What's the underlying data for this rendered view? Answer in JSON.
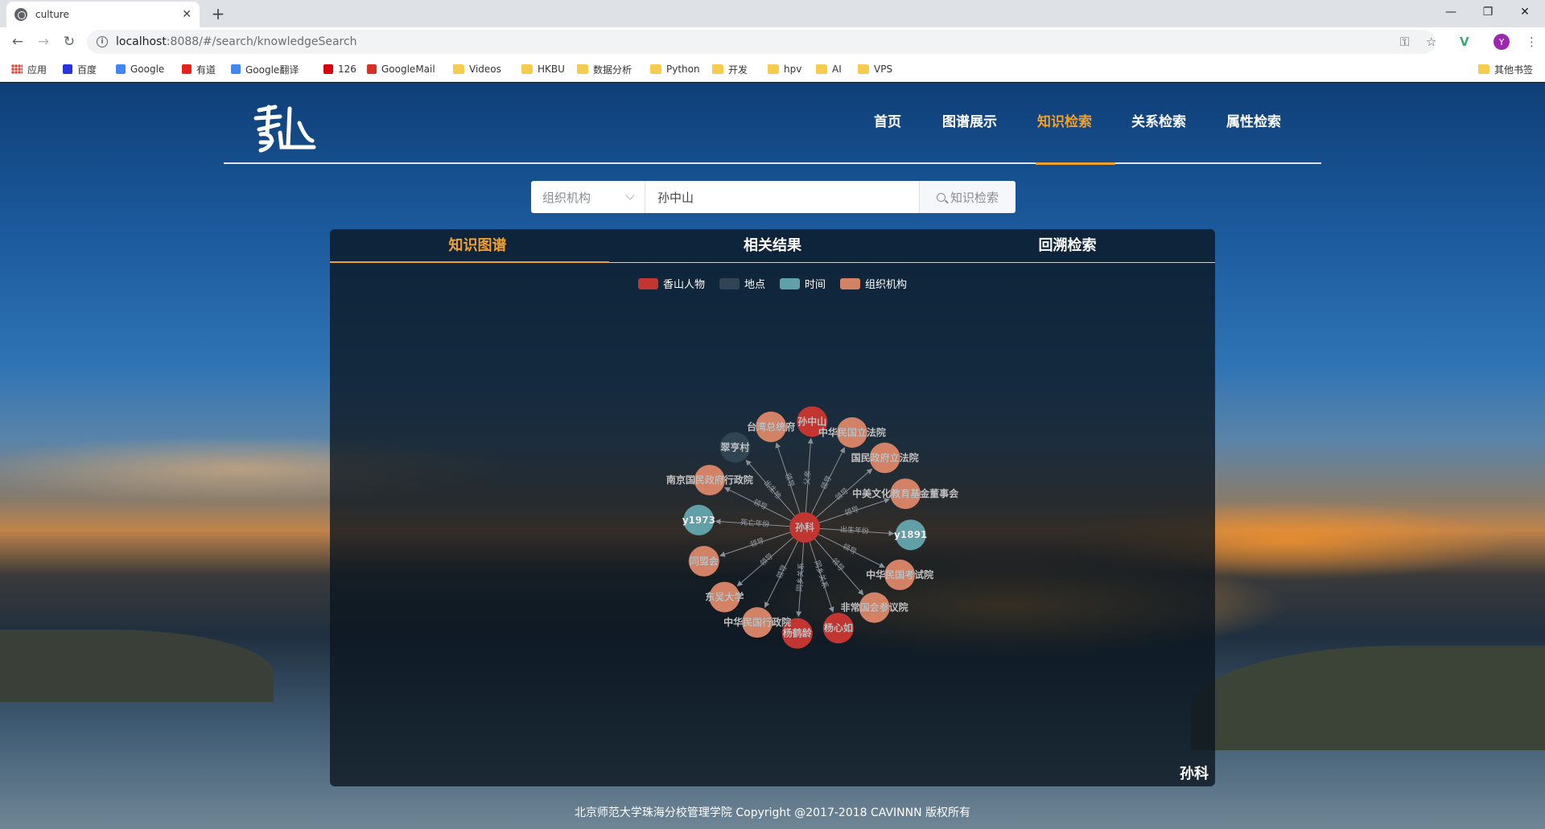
{
  "browser": {
    "tab_title": "culture",
    "url_host": "localhost",
    "url_path": ":8088/#/search/knowledgeSearch",
    "avatar_letter": "Y",
    "bookmarks": [
      {
        "label": "应用",
        "icon": "apps-icon"
      },
      {
        "label": "百度",
        "icon": "baidu-icon"
      },
      {
        "label": "Google",
        "icon": "google-icon"
      },
      {
        "label": "有道",
        "icon": "youdao-icon"
      },
      {
        "label": "Google翻译",
        "icon": "translate-icon"
      },
      {
        "label": "126",
        "icon": "netease-icon"
      },
      {
        "label": "GoogleMail",
        "icon": "gmail-icon"
      },
      {
        "label": "Videos",
        "icon": "folder-icon"
      },
      {
        "label": "HKBU",
        "icon": "folder-icon"
      },
      {
        "label": "数据分析",
        "icon": "folder-icon"
      },
      {
        "label": "Python",
        "icon": "folder-icon"
      },
      {
        "label": "开发",
        "icon": "folder-icon"
      },
      {
        "label": "hpv",
        "icon": "folder-icon"
      },
      {
        "label": "AI",
        "icon": "folder-icon"
      },
      {
        "label": "VPS",
        "icon": "folder-icon"
      }
    ],
    "other_bookmarks": "其他书签"
  },
  "header": {
    "nav": [
      "首页",
      "图谱展示",
      "知识检索",
      "关系检索",
      "属性检索"
    ],
    "active_index": 2
  },
  "search": {
    "category": "组织机构",
    "query": "孙中山",
    "button_label": "知识检索"
  },
  "panel": {
    "tabs": [
      "知识图谱",
      "相关结果",
      "回溯检索"
    ],
    "active_index": 0,
    "corner_label": "孙科"
  },
  "colors": {
    "person": "#c23531",
    "place": "#2f4554",
    "time": "#61a0a8",
    "org": "#d48265",
    "accent": "#f0a030"
  },
  "chart_data": {
    "type": "graph",
    "legend": [
      {
        "name": "香山人物",
        "category": "person"
      },
      {
        "name": "地点",
        "category": "place"
      },
      {
        "name": "时间",
        "category": "time"
      },
      {
        "name": "组织机构",
        "category": "org"
      }
    ],
    "center": {
      "name": "孙科",
      "category": "person"
    },
    "nodes": [
      {
        "name": "孙中山",
        "category": "person"
      },
      {
        "name": "中华民国立法院",
        "category": "org"
      },
      {
        "name": "国民政府立法院",
        "category": "org"
      },
      {
        "name": "中美文化教育基金董事会",
        "category": "org"
      },
      {
        "name": "y1891",
        "category": "time"
      },
      {
        "name": "中华民国考试院",
        "category": "org"
      },
      {
        "name": "非常国会参议院",
        "category": "org"
      },
      {
        "name": "杨心如",
        "category": "person"
      },
      {
        "name": "杨鹤龄",
        "category": "person"
      },
      {
        "name": "中华民国行政院",
        "category": "org"
      },
      {
        "name": "东吴大学",
        "category": "org"
      },
      {
        "name": "同盟会",
        "category": "org"
      },
      {
        "name": "y1973",
        "category": "time"
      },
      {
        "name": "南京国民政府行政院",
        "category": "org"
      },
      {
        "name": "翠亨村",
        "category": "place"
      },
      {
        "name": "台湾总统府",
        "category": "org"
      }
    ],
    "links": [
      {
        "target": "孙中山",
        "label": "父亲"
      },
      {
        "target": "中华民国立法院",
        "label": "领导"
      },
      {
        "target": "国民政府立法院",
        "label": "领导"
      },
      {
        "target": "中美文化教育基金董事会",
        "label": "领导"
      },
      {
        "target": "y1891",
        "label": "出生年份"
      },
      {
        "target": "中华民国考试院",
        "label": "领导"
      },
      {
        "target": "非常国会参议院",
        "label": "领导"
      },
      {
        "target": "杨心如",
        "label": "同乡关系"
      },
      {
        "target": "杨鹤龄",
        "label": "同乡关系"
      },
      {
        "target": "中华民国行政院",
        "label": "领导"
      },
      {
        "target": "东吴大学",
        "label": "领导"
      },
      {
        "target": "同盟会",
        "label": "领导"
      },
      {
        "target": "y1973",
        "label": "死亡年份"
      },
      {
        "target": "南京国民政府行政院",
        "label": "领导"
      },
      {
        "target": "翠亨村",
        "label": "出生地"
      },
      {
        "target": "台湾总统府",
        "label": "领导"
      }
    ]
  },
  "footer": "北京师范大学珠海分校管理学院 Copyright @2017-2018 CAVINNN 版权所有"
}
